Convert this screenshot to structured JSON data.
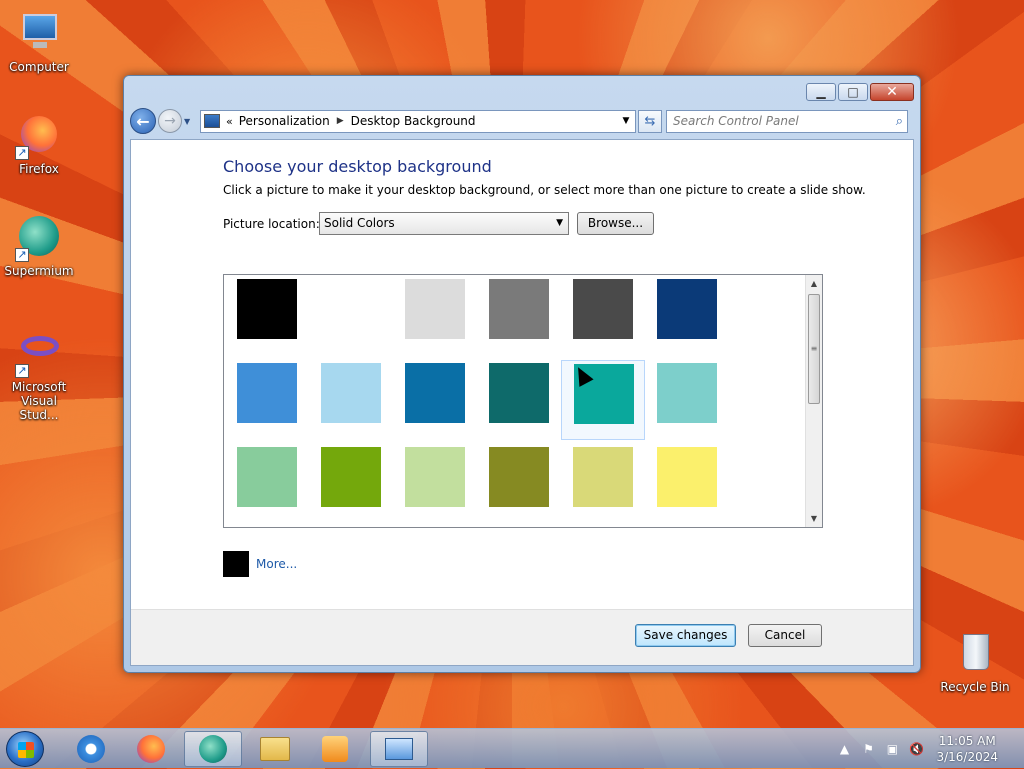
{
  "desktop": {
    "icons": [
      {
        "label": "Computer"
      },
      {
        "label": "Firefox"
      },
      {
        "label": "Supermium"
      },
      {
        "label": "Microsoft Visual Stud..."
      },
      {
        "label": "Recycle Bin"
      }
    ]
  },
  "window": {
    "breadcrumb": {
      "root": "Personalization",
      "current": "Desktop Background"
    },
    "search_placeholder": "Search Control Panel",
    "heading": "Choose your desktop background",
    "subtext": "Click a picture to make it your desktop background, or select more than one picture to create a slide show.",
    "picture_location_label": "Picture location:",
    "picture_location_value": "Solid Colors",
    "browse_label": "Browse...",
    "swatches": [
      {
        "color": "#000000"
      },
      {
        "color": "#ffffff"
      },
      {
        "color": "#dcdcdc"
      },
      {
        "color": "#7a7a7a"
      },
      {
        "color": "#4a4a4a"
      },
      {
        "color": "#0b3a78"
      },
      {
        "color": "#3f8fd8"
      },
      {
        "color": "#a7d8ef"
      },
      {
        "color": "#0a6fa6"
      },
      {
        "color": "#0e6a6a"
      },
      {
        "color": "#0aa89c",
        "selected": true
      },
      {
        "color": "#7dcfcb"
      },
      {
        "color": "#88cc9c"
      },
      {
        "color": "#74a80c"
      },
      {
        "color": "#c2df9e"
      },
      {
        "color": "#868a22"
      },
      {
        "color": "#d9d978"
      },
      {
        "color": "#fbf06c"
      }
    ],
    "more_label": "More...",
    "save_label": "Save changes",
    "cancel_label": "Cancel"
  },
  "taskbar": {
    "clock_time": "11:05 AM",
    "clock_date": "3/16/2024"
  }
}
